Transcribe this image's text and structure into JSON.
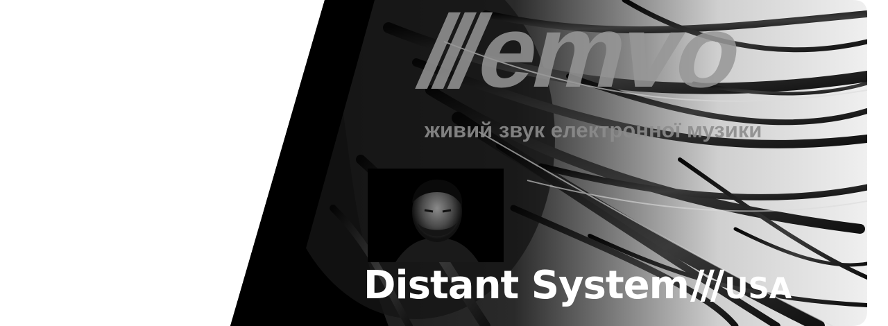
{
  "logo": {
    "slashes": "///",
    "wordmark": "emvo",
    "tagline": "живий звук електронної музики",
    "icon": "emvo-logo"
  },
  "artist": {
    "name": "Distant System",
    "separator": "///",
    "country": "USA",
    "photo_icon": "artist-portrait"
  },
  "colors": {
    "background": "#ffffff",
    "panel": "#000000",
    "text": "#ffffff",
    "logo": "#969696"
  }
}
